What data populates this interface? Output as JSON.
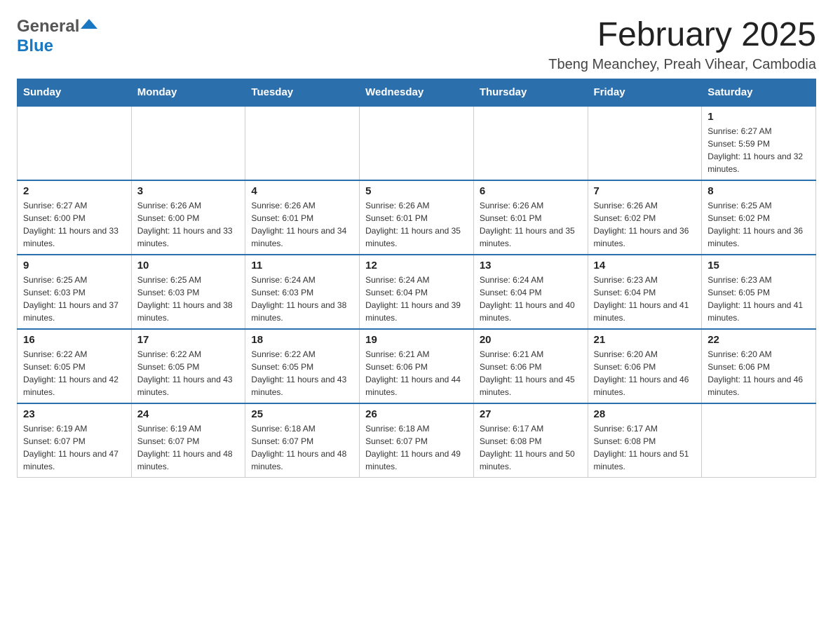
{
  "logo": {
    "general_text": "General",
    "blue_text": "Blue"
  },
  "title": {
    "month_year": "February 2025",
    "location": "Tbeng Meanchey, Preah Vihear, Cambodia"
  },
  "weekdays": [
    "Sunday",
    "Monday",
    "Tuesday",
    "Wednesday",
    "Thursday",
    "Friday",
    "Saturday"
  ],
  "weeks": [
    [
      {
        "day": "",
        "info": ""
      },
      {
        "day": "",
        "info": ""
      },
      {
        "day": "",
        "info": ""
      },
      {
        "day": "",
        "info": ""
      },
      {
        "day": "",
        "info": ""
      },
      {
        "day": "",
        "info": ""
      },
      {
        "day": "1",
        "info": "Sunrise: 6:27 AM\nSunset: 5:59 PM\nDaylight: 11 hours and 32 minutes."
      }
    ],
    [
      {
        "day": "2",
        "info": "Sunrise: 6:27 AM\nSunset: 6:00 PM\nDaylight: 11 hours and 33 minutes."
      },
      {
        "day": "3",
        "info": "Sunrise: 6:26 AM\nSunset: 6:00 PM\nDaylight: 11 hours and 33 minutes."
      },
      {
        "day": "4",
        "info": "Sunrise: 6:26 AM\nSunset: 6:01 PM\nDaylight: 11 hours and 34 minutes."
      },
      {
        "day": "5",
        "info": "Sunrise: 6:26 AM\nSunset: 6:01 PM\nDaylight: 11 hours and 35 minutes."
      },
      {
        "day": "6",
        "info": "Sunrise: 6:26 AM\nSunset: 6:01 PM\nDaylight: 11 hours and 35 minutes."
      },
      {
        "day": "7",
        "info": "Sunrise: 6:26 AM\nSunset: 6:02 PM\nDaylight: 11 hours and 36 minutes."
      },
      {
        "day": "8",
        "info": "Sunrise: 6:25 AM\nSunset: 6:02 PM\nDaylight: 11 hours and 36 minutes."
      }
    ],
    [
      {
        "day": "9",
        "info": "Sunrise: 6:25 AM\nSunset: 6:03 PM\nDaylight: 11 hours and 37 minutes."
      },
      {
        "day": "10",
        "info": "Sunrise: 6:25 AM\nSunset: 6:03 PM\nDaylight: 11 hours and 38 minutes."
      },
      {
        "day": "11",
        "info": "Sunrise: 6:24 AM\nSunset: 6:03 PM\nDaylight: 11 hours and 38 minutes."
      },
      {
        "day": "12",
        "info": "Sunrise: 6:24 AM\nSunset: 6:04 PM\nDaylight: 11 hours and 39 minutes."
      },
      {
        "day": "13",
        "info": "Sunrise: 6:24 AM\nSunset: 6:04 PM\nDaylight: 11 hours and 40 minutes."
      },
      {
        "day": "14",
        "info": "Sunrise: 6:23 AM\nSunset: 6:04 PM\nDaylight: 11 hours and 41 minutes."
      },
      {
        "day": "15",
        "info": "Sunrise: 6:23 AM\nSunset: 6:05 PM\nDaylight: 11 hours and 41 minutes."
      }
    ],
    [
      {
        "day": "16",
        "info": "Sunrise: 6:22 AM\nSunset: 6:05 PM\nDaylight: 11 hours and 42 minutes."
      },
      {
        "day": "17",
        "info": "Sunrise: 6:22 AM\nSunset: 6:05 PM\nDaylight: 11 hours and 43 minutes."
      },
      {
        "day": "18",
        "info": "Sunrise: 6:22 AM\nSunset: 6:05 PM\nDaylight: 11 hours and 43 minutes."
      },
      {
        "day": "19",
        "info": "Sunrise: 6:21 AM\nSunset: 6:06 PM\nDaylight: 11 hours and 44 minutes."
      },
      {
        "day": "20",
        "info": "Sunrise: 6:21 AM\nSunset: 6:06 PM\nDaylight: 11 hours and 45 minutes."
      },
      {
        "day": "21",
        "info": "Sunrise: 6:20 AM\nSunset: 6:06 PM\nDaylight: 11 hours and 46 minutes."
      },
      {
        "day": "22",
        "info": "Sunrise: 6:20 AM\nSunset: 6:06 PM\nDaylight: 11 hours and 46 minutes."
      }
    ],
    [
      {
        "day": "23",
        "info": "Sunrise: 6:19 AM\nSunset: 6:07 PM\nDaylight: 11 hours and 47 minutes."
      },
      {
        "day": "24",
        "info": "Sunrise: 6:19 AM\nSunset: 6:07 PM\nDaylight: 11 hours and 48 minutes."
      },
      {
        "day": "25",
        "info": "Sunrise: 6:18 AM\nSunset: 6:07 PM\nDaylight: 11 hours and 48 minutes."
      },
      {
        "day": "26",
        "info": "Sunrise: 6:18 AM\nSunset: 6:07 PM\nDaylight: 11 hours and 49 minutes."
      },
      {
        "day": "27",
        "info": "Sunrise: 6:17 AM\nSunset: 6:08 PM\nDaylight: 11 hours and 50 minutes."
      },
      {
        "day": "28",
        "info": "Sunrise: 6:17 AM\nSunset: 6:08 PM\nDaylight: 11 hours and 51 minutes."
      },
      {
        "day": "",
        "info": ""
      }
    ]
  ]
}
